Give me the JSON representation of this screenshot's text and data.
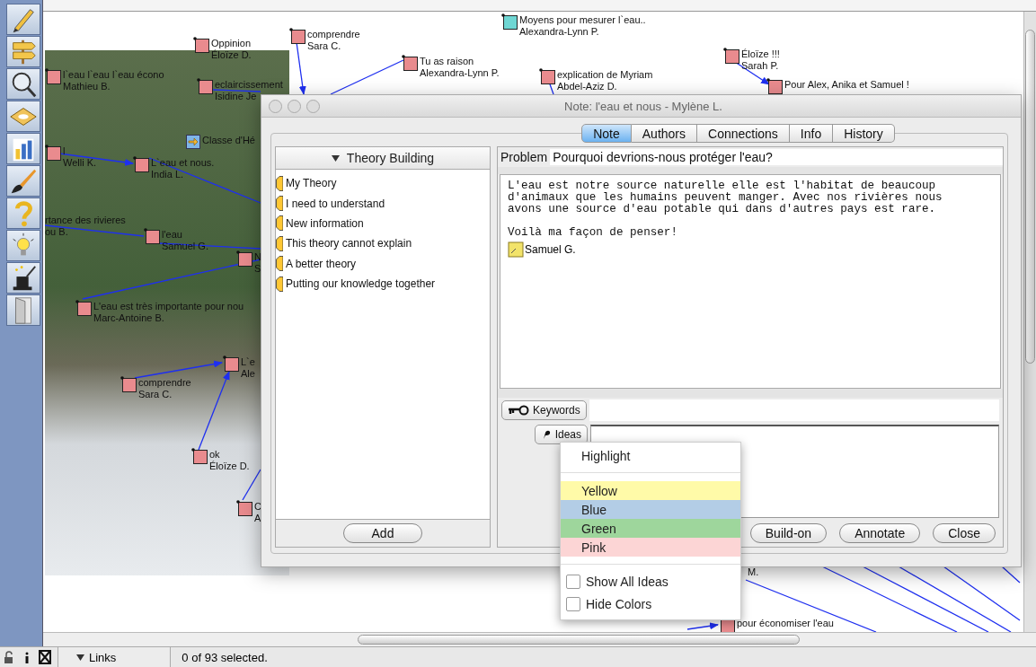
{
  "canvas": {
    "nodes": [
      {
        "kind": "note",
        "color": "#e98b8e",
        "title": "Oppinion",
        "author": "Éloïze  D."
      },
      {
        "kind": "note",
        "color": "#e98b8e",
        "title": "comprendre",
        "author": "Sara C."
      },
      {
        "kind": "note",
        "color": "#6fd6d3",
        "title": "Moyens pour mesurer l`eau..",
        "author": "Alexandra-Lynn  P."
      },
      {
        "kind": "note",
        "color": "#e98b8e",
        "title": "Tu   as raison",
        "author": "Alexandra-Lynn  P."
      },
      {
        "kind": "note",
        "color": "#e98b8e",
        "title": "l`eau  l`eau l`eau  écono",
        "author": "Mathieu  B."
      },
      {
        "kind": "note",
        "color": "#e98b8e",
        "title": "eclaircissement",
        "author": "Isidine Je"
      },
      {
        "kind": "note",
        "color": "#e98b8e",
        "title": "explication de Myriam",
        "author": "Abdel-Aziz D."
      },
      {
        "kind": "note",
        "color": "#e98b8e",
        "title": "Éloïze !!!",
        "author": "Sarah  P."
      },
      {
        "kind": "note",
        "color": "#e98b8e",
        "title": "Pour Alex, Anika et Samuel !"
      },
      {
        "kind": "link",
        "title": "Classe d'Hé"
      },
      {
        "kind": "note",
        "color": "#e98b8e",
        "title": "l",
        "author": "Welli K."
      },
      {
        "kind": "note",
        "color": "#e98b8e",
        "title": "L`eau et nous.",
        "author": "India  L."
      },
      {
        "kind": "clipped",
        "title": "rtance des rivieres",
        "author": "ou B."
      },
      {
        "kind": "note",
        "color": "#e98b8e",
        "title": "l'eau",
        "author": "Samuel  G."
      },
      {
        "kind": "note",
        "color": "#e98b8e",
        "title": "N",
        "author": "S"
      },
      {
        "kind": "note",
        "color": "#e98b8e",
        "title": "L'eau est très importante pour nou",
        "author": "Marc-Antoine  B."
      },
      {
        "kind": "note",
        "color": "#e98b8e",
        "title": "L`e",
        "author": "Ale"
      },
      {
        "kind": "note",
        "color": "#e98b8e",
        "title": "comprendre",
        "author": "Sara C."
      },
      {
        "kind": "note",
        "color": "#e98b8e",
        "title": "ok",
        "author": "Éloïze  D."
      },
      {
        "kind": "note",
        "color": "#e98b8e",
        "title": "C",
        "author": "A"
      },
      {
        "kind": "clipped",
        "title": "M."
      },
      {
        "kind": "note",
        "color": "#e98b8e",
        "title": "pour économiser l'eau"
      }
    ]
  },
  "dialog": {
    "title": "Note: l'eau et nous - Mylène  L.",
    "tabs": [
      {
        "label": "Note",
        "selected": true
      },
      {
        "label": "Authors",
        "selected": false
      },
      {
        "label": "Connections",
        "selected": false
      },
      {
        "label": "Info",
        "selected": false
      },
      {
        "label": "History",
        "selected": false
      }
    ],
    "scaffold": {
      "title": "Theory Building",
      "items": [
        "My Theory",
        "I need to understand",
        "New information",
        "This theory cannot explain",
        "A better theory",
        "Putting our knowledge together"
      ],
      "add_button": "Add"
    },
    "note": {
      "problem_label": "Problem",
      "problem": "Pourquoi devrions-nous protéger l'eau?",
      "paragraphs": [
        "L'eau est notre source naturelle elle est l'habitat de beaucoup\nd'animaux que les humains peuvent manger. Avec nos rivières nous\navons une source d'eau potable qui dans d'autres pays est rare.",
        "Voilà ma façon de penser!"
      ],
      "reference": "Samuel G.",
      "keywords_button": "Keywords",
      "ideas_button": "Ideas",
      "buttons": [
        "Build-on",
        "Annotate",
        "Close"
      ]
    }
  },
  "highlight_menu": {
    "title": "Highlight",
    "colors": [
      {
        "label": "Yellow",
        "color": "#fffaa8"
      },
      {
        "label": "Blue",
        "color": "#b3cde6"
      },
      {
        "label": "Green",
        "color": "#9ed69c"
      },
      {
        "label": "Pink",
        "color": "#fcd5d5"
      }
    ],
    "options": [
      {
        "label": "Show All Ideas",
        "checked": false
      },
      {
        "label": "Hide Colors",
        "checked": false
      }
    ]
  },
  "status_bar": {
    "view_menu": "Links",
    "selection": "0 of 93 selected."
  }
}
